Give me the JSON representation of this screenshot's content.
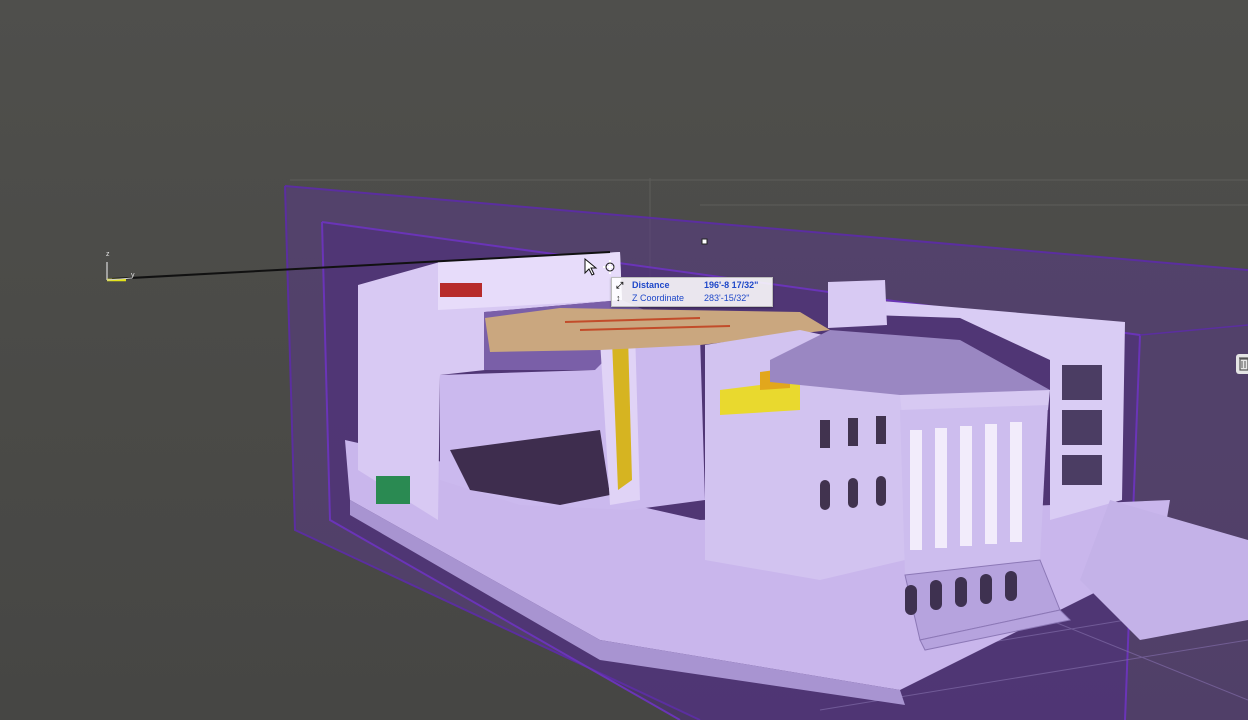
{
  "viewport": {
    "background": "#4d4d4a",
    "accent_section_box": "#5b2ea0",
    "model_color": "#c8b3ea"
  },
  "axis_triad": {
    "z_label": "z",
    "y_label": "y"
  },
  "measure_tooltip": {
    "distance_label": "Distance",
    "distance_value": "196'-8 17/32\"",
    "z_label": "Z Coordinate",
    "z_value": "283'-15/32\"",
    "distance_icon": "diagonal-arrow-icon",
    "z_icon": "z-axis-arrow-icon"
  },
  "cursor": {
    "icon": "move-cursor-icon"
  },
  "side_tool": {
    "icon": "trash-icon"
  }
}
